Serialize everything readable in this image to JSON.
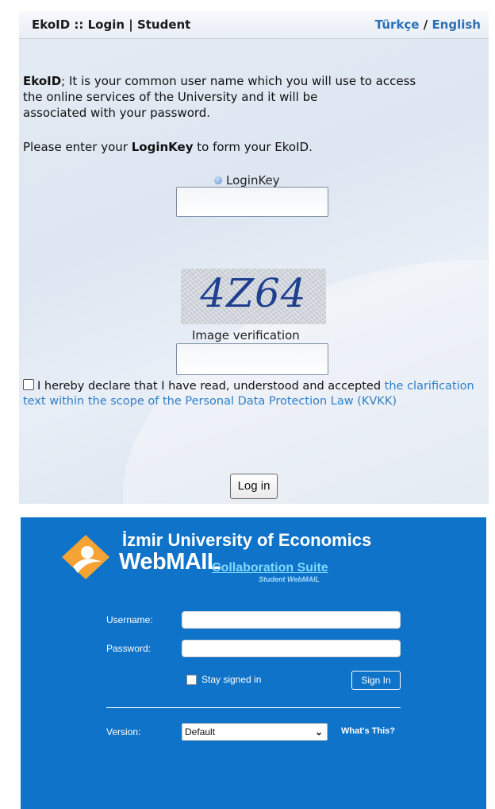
{
  "ekoid": {
    "title": "EkoID :: Login | Student",
    "lang_turkish": "Türkçe",
    "lang_separator": "/",
    "lang_english": "English",
    "intro_bold": "EkoID",
    "intro_line1_rest": "; It is your common user name which you will use to access",
    "intro_line2": "the online services of the University and it will be",
    "intro_line3": "associated with your password.",
    "prompt_pre": "Please enter your ",
    "prompt_bold": "LoginKey",
    "prompt_post": " to form your EkoID.",
    "loginkey_label": "LoginKey",
    "captcha_text": "4Z64",
    "image_verification_label": "Image verification",
    "kvkk_text": "I hereby declare that I have read, understood and accepted ",
    "kvkk_link": "the clarification text within the scope of the Personal Data Protection Law (KVKK)",
    "login_button": "Log in"
  },
  "webmail": {
    "university": "İzmir University of Economics",
    "brand": "WebMAIL",
    "suite": "Collaboration Suite",
    "subtitle": "Student WebMAIL",
    "username_label": "Username:",
    "password_label": "Password:",
    "stay_signed_in": "Stay signed in",
    "sign_in_button": "Sign In",
    "version_label": "Version:",
    "version_selected": "Default",
    "whats_this": "What's This?",
    "brand_color": "#0e73c9",
    "logo_color": "#f5a334"
  }
}
